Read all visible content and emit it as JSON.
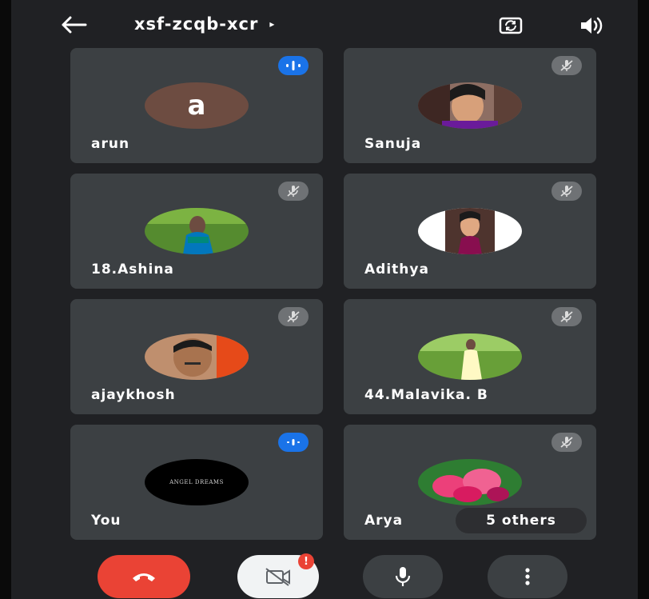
{
  "header": {
    "meeting_code": "xsf-zcqb-xcr",
    "caret": "▸"
  },
  "participants": [
    {
      "name": "arun",
      "avatar_letter": "a",
      "status": "speaking"
    },
    {
      "name": "Sanuja",
      "status": "muted"
    },
    {
      "name": "18.Ashina",
      "status": "muted"
    },
    {
      "name": "Adithya",
      "status": "muted"
    },
    {
      "name": "ajaykhosh",
      "status": "muted"
    },
    {
      "name": "44.Malavika. B",
      "status": "muted"
    },
    {
      "name": "You",
      "avatar_text": "ANGEL DREAMS",
      "status": "speaking"
    },
    {
      "name": "Arya",
      "status": "muted"
    }
  ],
  "others_label": "5 others",
  "controls": {
    "camera_warning": "!"
  },
  "colors": {
    "background": "#202124",
    "tile": "#3c4043",
    "end_call": "#ea4335",
    "speaking_badge": "#1a73e8",
    "muted_badge": "#6f7275"
  },
  "icons": [
    "back-arrow-icon",
    "switch-camera-icon",
    "speaker-icon",
    "mic-off-icon",
    "audio-level-icon",
    "call-end-icon",
    "video-off-icon",
    "mic-icon",
    "more-vert-icon"
  ]
}
